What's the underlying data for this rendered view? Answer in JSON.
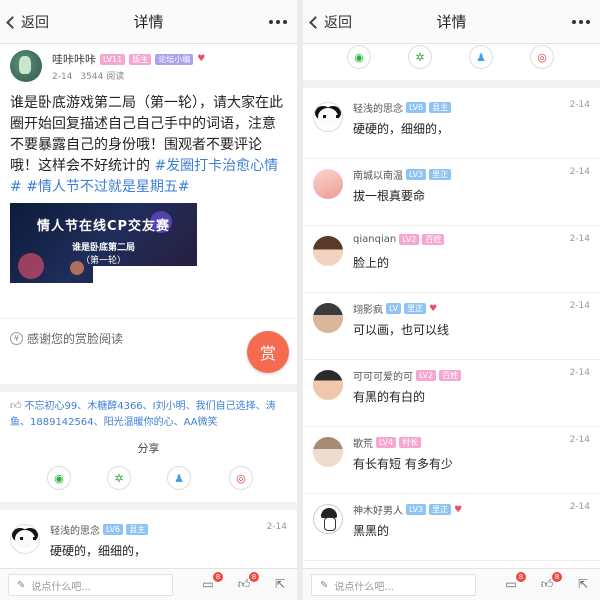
{
  "nav": {
    "back_label": "返回",
    "title": "详情"
  },
  "post": {
    "author": "哇咔咔咔",
    "level": "LV11",
    "badge_mod": "版主",
    "badge_forum": "论坛小编",
    "date": "2-14",
    "reads": "3544 阅读",
    "text": "谁是卧底游戏第二局（第一轮），请大家在此圈开始回复描述自己自己手中的词语，注意不要暴露自己的身份哦！围观者不要评论哦！这样会不好统计的 ",
    "tags": [
      "#发圈打卡治愈心情#",
      "#情人节不过就是星期五#"
    ],
    "image": {
      "title": "情人节在线CP交友赛",
      "subtitle": "谁是卧底第二局",
      "round": "（第一轮）"
    }
  },
  "reward": {
    "text": "感谢您的赏脸阅读",
    "button": "赏"
  },
  "likes": {
    "users": "不忘初心99、木糖醇4366、I刘小明、我们自己选择、涛鱼、1889142564、阳光温暖你的心、AA微笑"
  },
  "share": {
    "label": "分享",
    "icons": [
      "wechat-icon",
      "moments-icon",
      "qq-icon",
      "weibo-icon"
    ]
  },
  "left_comments": [
    {
      "name": "轻浅的思念",
      "level": "LV6",
      "badge": "县主",
      "date": "2-14",
      "text": "硬硬的，细细的，",
      "avatar": "panda"
    }
  ],
  "right_comments": [
    {
      "name": "轻浅的思念",
      "level": "LV6",
      "badge": "县主",
      "date": "2-14",
      "text": "硬硬的，细细的，",
      "avatar": "panda"
    },
    {
      "name": "南城以南温",
      "level": "LV3",
      "badge": "里正",
      "date": "2-14",
      "text": "拔一根真要命",
      "avatar": "peach"
    },
    {
      "name": "qianqian",
      "level": "LV2",
      "badge": "百姓",
      "date": "2-14",
      "text": "脸上的",
      "avatar": "girl"
    },
    {
      "name": "翊影疯",
      "level": "LV",
      "badge": "里正",
      "date": "2-14",
      "text": "可以画，也可以线",
      "avatar": "boy",
      "heart": true
    },
    {
      "name": "可可可爱的可",
      "level": "LV2",
      "badge": "百姓",
      "date": "2-14",
      "text": "有黑的有白的",
      "avatar": "kid"
    },
    {
      "name": "歌荒",
      "level": "LV4",
      "badge": "村长",
      "date": "2-14",
      "text": "有长有短 有多有少",
      "avatar": "doll"
    },
    {
      "name": "神木好男人",
      "level": "LV3",
      "badge": "里正",
      "date": "2-14",
      "text": "黑黑的",
      "avatar": "sketch",
      "heart": true
    }
  ],
  "bottom": {
    "placeholder": "说点什么吧...",
    "comment_count": "8",
    "like_count": "8"
  },
  "colors": {
    "accent": "#3e7fd6",
    "reward": "#f46b4f",
    "badge_red": "#f04a3e"
  }
}
